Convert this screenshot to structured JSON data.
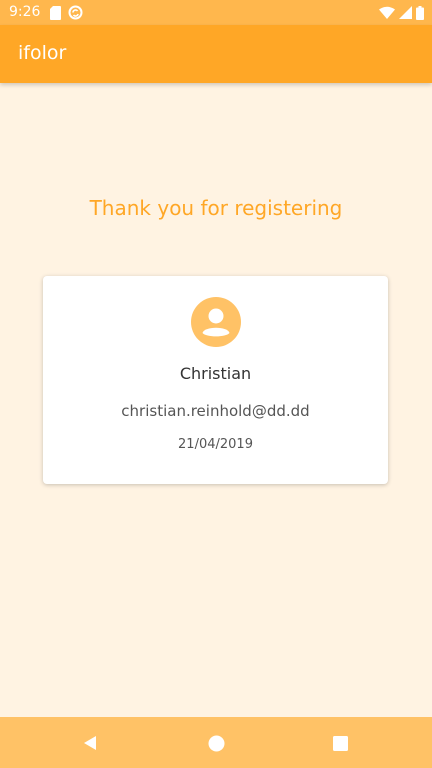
{
  "status_bar": {
    "time": "9:26",
    "left_icons": [
      "sd-card-icon",
      "sync-icon"
    ],
    "right_icons": [
      "wifi-icon",
      "signal-icon",
      "battery-icon"
    ]
  },
  "app_bar": {
    "title": "ifolor"
  },
  "main": {
    "message": "Thank you for registering",
    "card": {
      "avatar_icon": "account-circle-icon",
      "name": "Christian",
      "email": "christian.reinhold@dd.dd",
      "date": "21/04/2019"
    }
  },
  "nav_bar": {
    "buttons": [
      "back-icon",
      "home-icon",
      "recents-icon"
    ]
  },
  "colors": {
    "status_bar": "#ffb74d",
    "app_bar": "#ffa726",
    "background": "#fff3e2",
    "accent": "#ffa726",
    "avatar": "#ffc266",
    "nav_bar": "#ffc266"
  }
}
